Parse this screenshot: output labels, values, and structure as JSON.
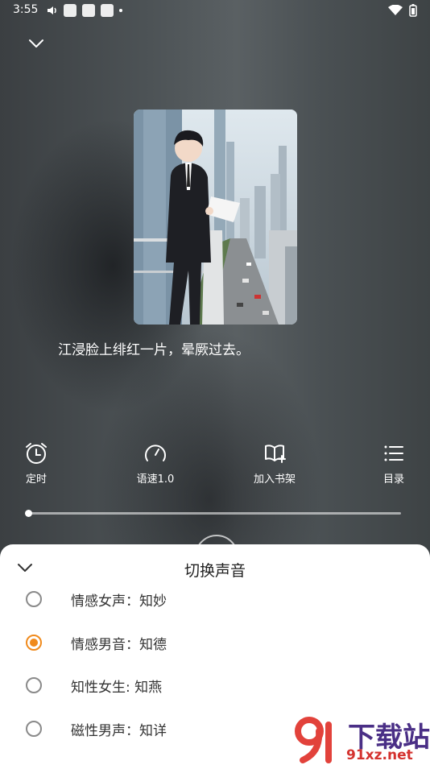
{
  "status_bar": {
    "time": "3:55"
  },
  "cover_scene": "anime-man-reading-paper-on-balcony-city-skyline",
  "subtitle": "江浸脸上绯红一片，晕厥过去。",
  "controls": [
    {
      "label": "定时",
      "icon": "alarm-clock-icon"
    },
    {
      "label": "语速1.0",
      "icon": "speed-gauge-icon"
    },
    {
      "label": "加入书架",
      "icon": "add-bookshelf-icon"
    },
    {
      "label": "目录",
      "icon": "list-icon"
    }
  ],
  "playback": {
    "progress": 0.0
  },
  "voice_sheet": {
    "title": "切换声音",
    "options": [
      {
        "label": "情感女声：知妙",
        "selected": false
      },
      {
        "label": "情感男音：知德",
        "selected": true
      },
      {
        "label": "知性女生: 知燕",
        "selected": false
      },
      {
        "label": "磁性男声：知详",
        "selected": false
      }
    ]
  },
  "watermark": {
    "brand": "下载站",
    "url": "91xz.net"
  },
  "colors": {
    "accent": "#f08a1c",
    "sheet_bg": "#ffffff"
  }
}
